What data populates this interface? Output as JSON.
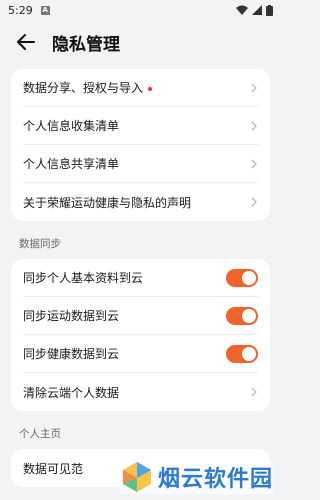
{
  "status_bar": {
    "time": "5:29",
    "notification_letter": "A"
  },
  "header": {
    "title": "隐私管理"
  },
  "card1": {
    "items": [
      {
        "label": "数据分享、授权与导入"
      },
      {
        "label": "个人信息收集清单"
      },
      {
        "label": "个人信息共享清单"
      },
      {
        "label": "关于荣耀运动健康与隐私的声明"
      }
    ]
  },
  "sync": {
    "section_title": "数据同步",
    "items": [
      {
        "label": "同步个人基本资料到云",
        "enabled": true
      },
      {
        "label": "同步运动数据到云",
        "enabled": true
      },
      {
        "label": "同步健康数据到云",
        "enabled": true
      },
      {
        "label": "清除云端个人数据"
      }
    ]
  },
  "profile": {
    "section_title": "个人主页",
    "items": [
      {
        "label": "数据可见范"
      }
    ]
  },
  "watermark": {
    "text": "烟云软件园"
  },
  "colors": {
    "accent": "#f0642b",
    "badge": "#e5342f",
    "background": "#f1f3f5"
  }
}
